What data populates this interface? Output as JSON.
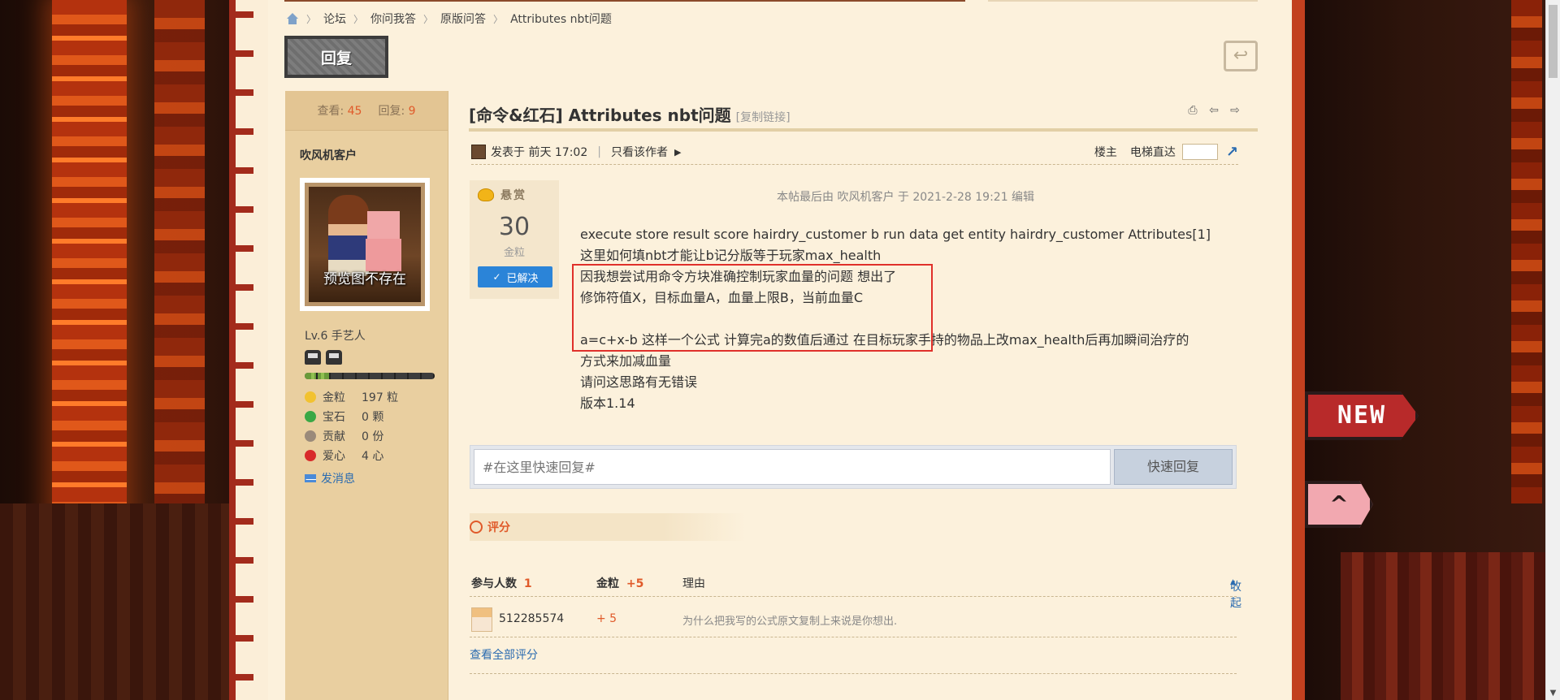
{
  "breadcrumb": {
    "items": [
      "论坛",
      "你问我答",
      "原版问答",
      "Attributes nbt问题"
    ]
  },
  "actions": {
    "reply_label": "回复"
  },
  "user": {
    "views_label": "查看:",
    "views": "45",
    "replies_label": "回复:",
    "replies": "9",
    "name": "吹风机客户",
    "avatar_caption": "预览图不存在",
    "level": "Lv.6 手艺人",
    "exp_progress": 0.2,
    "credits": [
      {
        "label": "金粒",
        "value": "197 粒",
        "icon": "gold-nugget-icon",
        "color": "#f2c230"
      },
      {
        "label": "宝石",
        "value": "0 颗",
        "icon": "emerald-icon",
        "color": "#3aa845"
      },
      {
        "label": "贡献",
        "value": "0 份",
        "icon": "contribution-icon",
        "color": "#9a8a7a"
      },
      {
        "label": "爱心",
        "value": "4 心",
        "icon": "heart-icon",
        "color": "#d82a2a"
      }
    ],
    "send_message": "发消息"
  },
  "post": {
    "title": "[命令&红石] Attributes nbt问题",
    "copy_link": "[复制链接]",
    "meta_posted": "发表于 前天 17:02",
    "meta_only_author": "只看该作者",
    "floor_label": "楼主",
    "elevator_label": "电梯直达",
    "reward_label": "悬赏",
    "reward_amount": "30",
    "reward_unit": "金粒",
    "solved_label": "已解决",
    "edit_note": "本帖最后由 吹风机客户 于 2021-2-28 19:21 编辑",
    "lines": [
      "execute store result score hairdry_customer b run data get entity hairdry_customer Attributes[1]",
      "这里如何填nbt才能让b记分版等于玩家max_health",
      "因我想尝试用命令方块准确控制玩家血量的问题 想出了",
      "修饰符值X，目标血量A，血量上限B，当前血量C",
      "",
      "a=c+x-b 这样一个公式 计算完a的数值后通过 在目标玩家手持的物品上改max_health后再加瞬间治疗的",
      "方式来加减血量",
      "请问这思路有无错误",
      "版本1.14"
    ]
  },
  "quick_reply": {
    "placeholder": "#在这里快速回复#",
    "button_label": "快速回复"
  },
  "rating": {
    "section_label": "评分",
    "participants_label": "参与人数",
    "participants_count": "1",
    "currency_label": "金粒",
    "currency_total": "+5",
    "reason_label": "理由",
    "collapse_label": "收起",
    "rows": [
      {
        "user": "512285574",
        "amount": "+ 5",
        "reason": "为什么把我写的公式原文复制上来说是你想出."
      }
    ],
    "view_all": "查看全部评分"
  },
  "badges": {
    "new": "NEW",
    "top": "^"
  }
}
